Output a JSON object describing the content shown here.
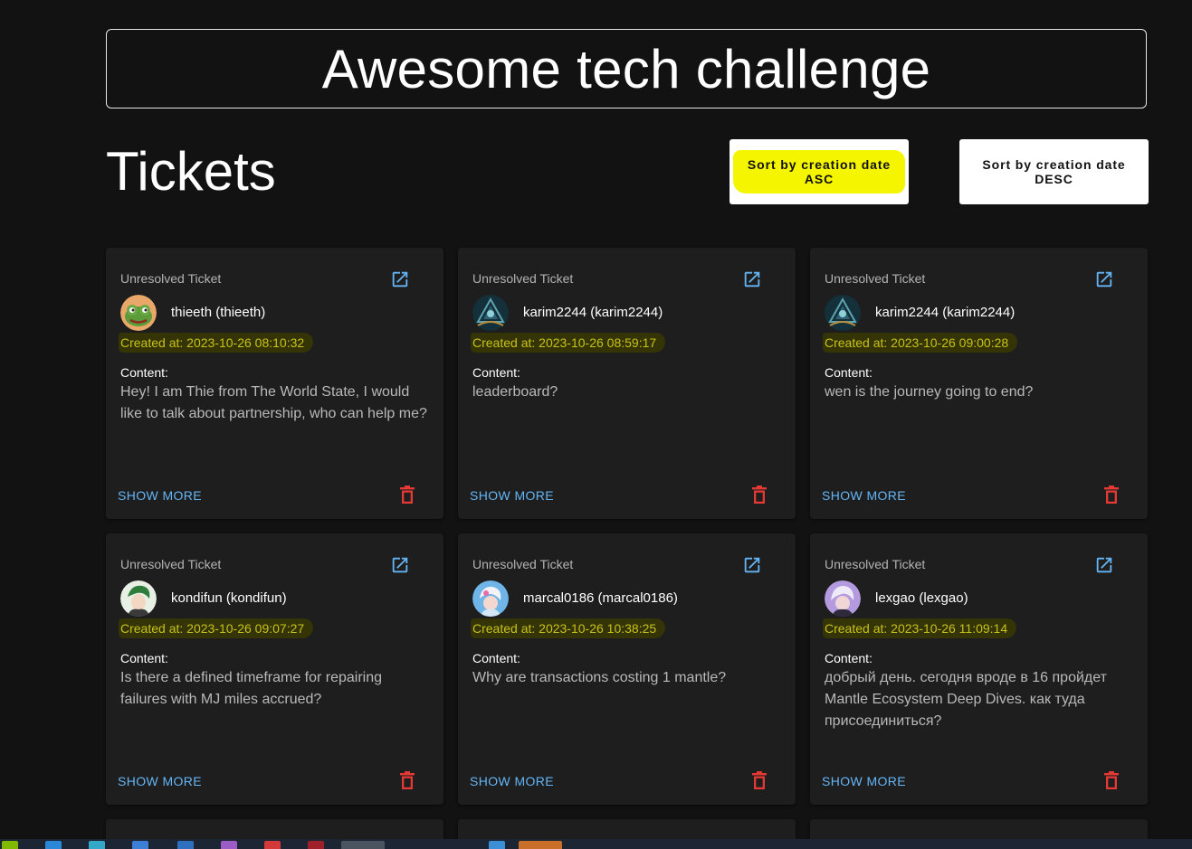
{
  "header": {
    "title": "Awesome tech challenge"
  },
  "section": {
    "title": "Tickets"
  },
  "sort": {
    "asc_label": "Sort by creation date ASC",
    "desc_label": "Sort by creation date DESC"
  },
  "tickets": [
    {
      "status": "Unresolved Ticket",
      "author": "thieeth (thieeth)",
      "created": "Created at: 2023-10-26 08:10:32",
      "content_label": "Content:",
      "content": "Hey! I am Thie from The World State, I would like to talk about partnership, who can help me?",
      "show_more": "SHOW MORE",
      "avatar_icon": "frog-avatar-icon"
    },
    {
      "status": "Unresolved Ticket",
      "author": "karim2244 (karim2244)",
      "created": "Created at: 2023-10-26 08:59:17",
      "content_label": "Content:",
      "content": "leaderboard?",
      "show_more": "SHOW MORE",
      "avatar_icon": "emblem-avatar-icon"
    },
    {
      "status": "Unresolved Ticket",
      "author": "karim2244 (karim2244)",
      "created": "Created at: 2023-10-26 09:00:28",
      "content_label": "Content:",
      "content": "wen is the journey going to end?",
      "show_more": "SHOW MORE",
      "avatar_icon": "emblem-avatar-icon"
    },
    {
      "status": "Unresolved Ticket",
      "author": "kondifun (kondifun)",
      "created": "Created at: 2023-10-26 09:07:27",
      "content_label": "Content:",
      "content": "Is there a defined timeframe for repairing failures with MJ miles accrued?",
      "show_more": "SHOW MORE",
      "avatar_icon": "anime-avatar-icon"
    },
    {
      "status": "Unresolved Ticket",
      "author": "marcal0186 (marcal0186)",
      "created": "Created at: 2023-10-26 10:38:25",
      "content_label": "Content:",
      "content": "Why are transactions costing 1 mantle?",
      "show_more": "SHOW MORE",
      "avatar_icon": "anime-avatar-icon"
    },
    {
      "status": "Unresolved Ticket",
      "author": "lexgao (lexgao)",
      "created": "Created at: 2023-10-26 11:09:14",
      "content_label": "Content:",
      "content": "добрый день. сегодня вроде в 16 пройдет Mantle Ecosystem Deep Dives. как туда присоединиться?",
      "show_more": "SHOW MORE",
      "avatar_icon": "anime-avatar-icon"
    }
  ],
  "colors": {
    "background": "#121212",
    "card": "#1e1e1e",
    "link": "#64b5f6",
    "delete": "#e53935",
    "highlight": "#f5f500",
    "created_text": "#c7c21a"
  }
}
